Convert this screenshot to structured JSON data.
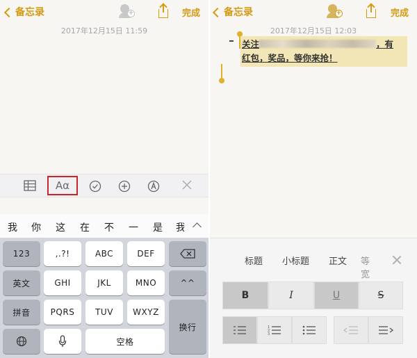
{
  "left": {
    "nav": {
      "back_label": "备忘录",
      "done_label": "完成"
    },
    "date": "2017年12月15日 11:59",
    "toolbar": {
      "aa_label": "Aα"
    },
    "candidates": [
      "我",
      "你",
      "这",
      "在",
      "不",
      "一",
      "是",
      "我"
    ],
    "keyboard": {
      "row1": [
        "123",
        ",.?!",
        "ABC",
        "DEF"
      ],
      "row2": [
        "英文",
        "GHI",
        "JKL",
        "MNO",
        "^^"
      ],
      "row3": [
        "拼音",
        "PQRS",
        "TUV",
        "WXYZ"
      ],
      "return_label": "换行",
      "space_label": "空格"
    }
  },
  "right": {
    "nav": {
      "back_label": "备忘录",
      "done_label": "完成"
    },
    "date": "2017年12月15日 12:03",
    "note": {
      "line1_start": "关注",
      "line1_end": "，有",
      "line2": "红包，奖品，等你来抢！"
    },
    "format_panel": {
      "styles": [
        "标题",
        "小标题",
        "正文",
        "等宽"
      ],
      "buttons": {
        "bold": "B",
        "italic": "I",
        "underline": "U",
        "strike": "S"
      }
    }
  }
}
